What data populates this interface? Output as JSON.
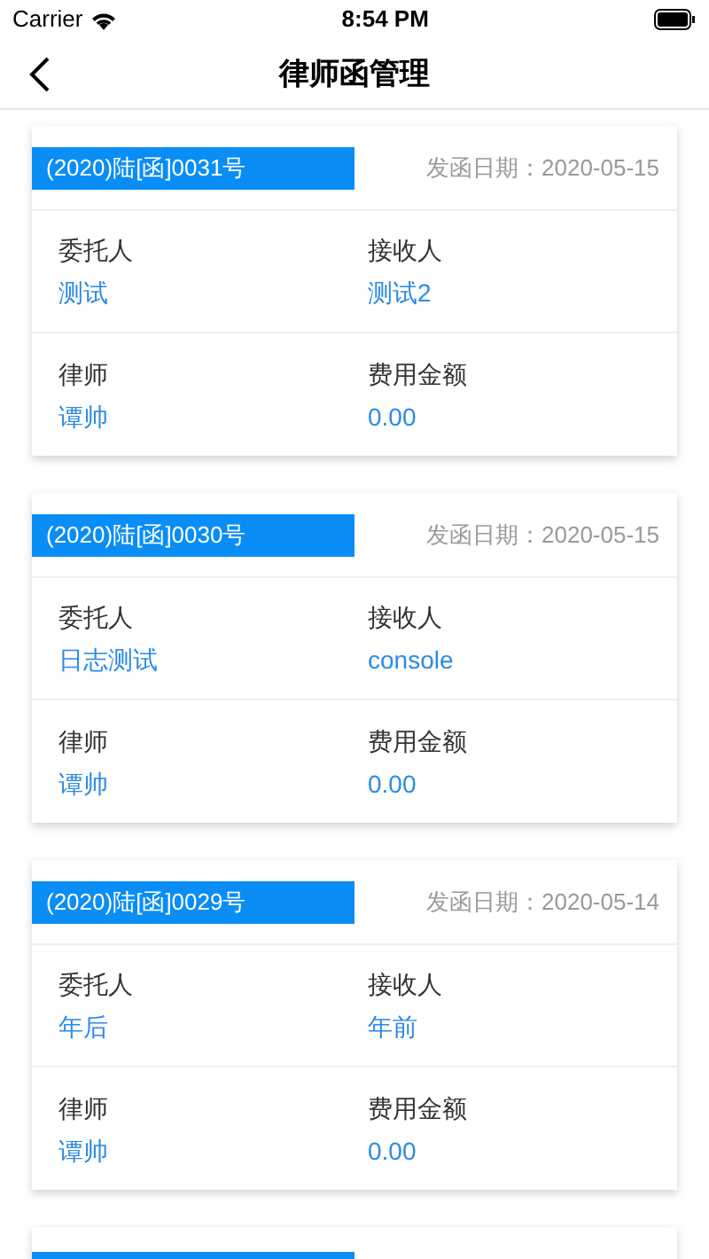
{
  "status_bar": {
    "carrier": "Carrier",
    "time": "8:54 PM"
  },
  "nav": {
    "title": "律师函管理"
  },
  "letters": [
    {
      "number": "(2020)陆[函]0031号",
      "date_label": "发函日期：",
      "date": "2020-05-15",
      "fields": [
        {
          "label": "委托人",
          "value": "测试"
        },
        {
          "label": "接收人",
          "value": "测试2"
        },
        {
          "label": "律师",
          "value": "谭帅"
        },
        {
          "label": "费用金额",
          "value": "0.00"
        }
      ]
    },
    {
      "number": "(2020)陆[函]0030号",
      "date_label": "发函日期：",
      "date": "2020-05-15",
      "fields": [
        {
          "label": "委托人",
          "value": "日志测试"
        },
        {
          "label": "接收人",
          "value": "console"
        },
        {
          "label": "律师",
          "value": "谭帅"
        },
        {
          "label": "费用金额",
          "value": "0.00"
        }
      ]
    },
    {
      "number": "(2020)陆[函]0029号",
      "date_label": "发函日期：",
      "date": "2020-05-14",
      "fields": [
        {
          "label": "委托人",
          "value": "年后"
        },
        {
          "label": "接收人",
          "value": "年前"
        },
        {
          "label": "律师",
          "value": "谭帅"
        },
        {
          "label": "费用金额",
          "value": "0.00"
        }
      ]
    },
    {
      "kind": "partial"
    }
  ]
}
